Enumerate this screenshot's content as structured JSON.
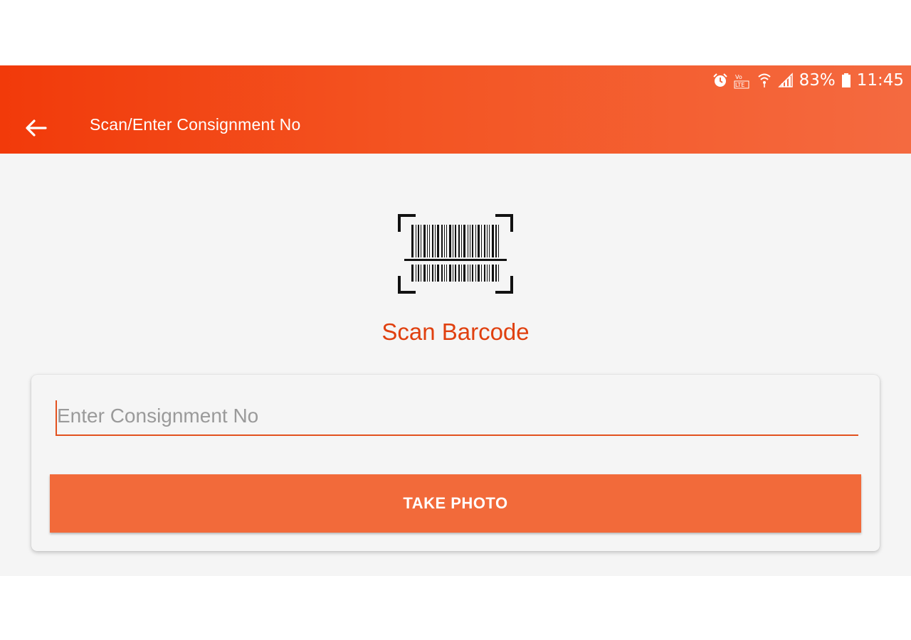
{
  "status_bar": {
    "battery": "83%",
    "time": "11:45",
    "icons": [
      "alarm-icon",
      "volte-icon",
      "wifi-icon",
      "signal-icon",
      "battery-icon"
    ]
  },
  "app_bar": {
    "title": "Scan/Enter Consignment No",
    "back_icon": "arrow-back-icon",
    "gradient": [
      "#f23a0a",
      "#f46a40"
    ]
  },
  "scan": {
    "icon": "barcode-scan-icon",
    "label": "Scan Barcode",
    "label_color": "#e0400f"
  },
  "form": {
    "consignment_placeholder": "Enter Consignment No",
    "consignment_value": "",
    "take_photo_label": "TAKE PHOTO",
    "button_color": "#f26a3a"
  }
}
